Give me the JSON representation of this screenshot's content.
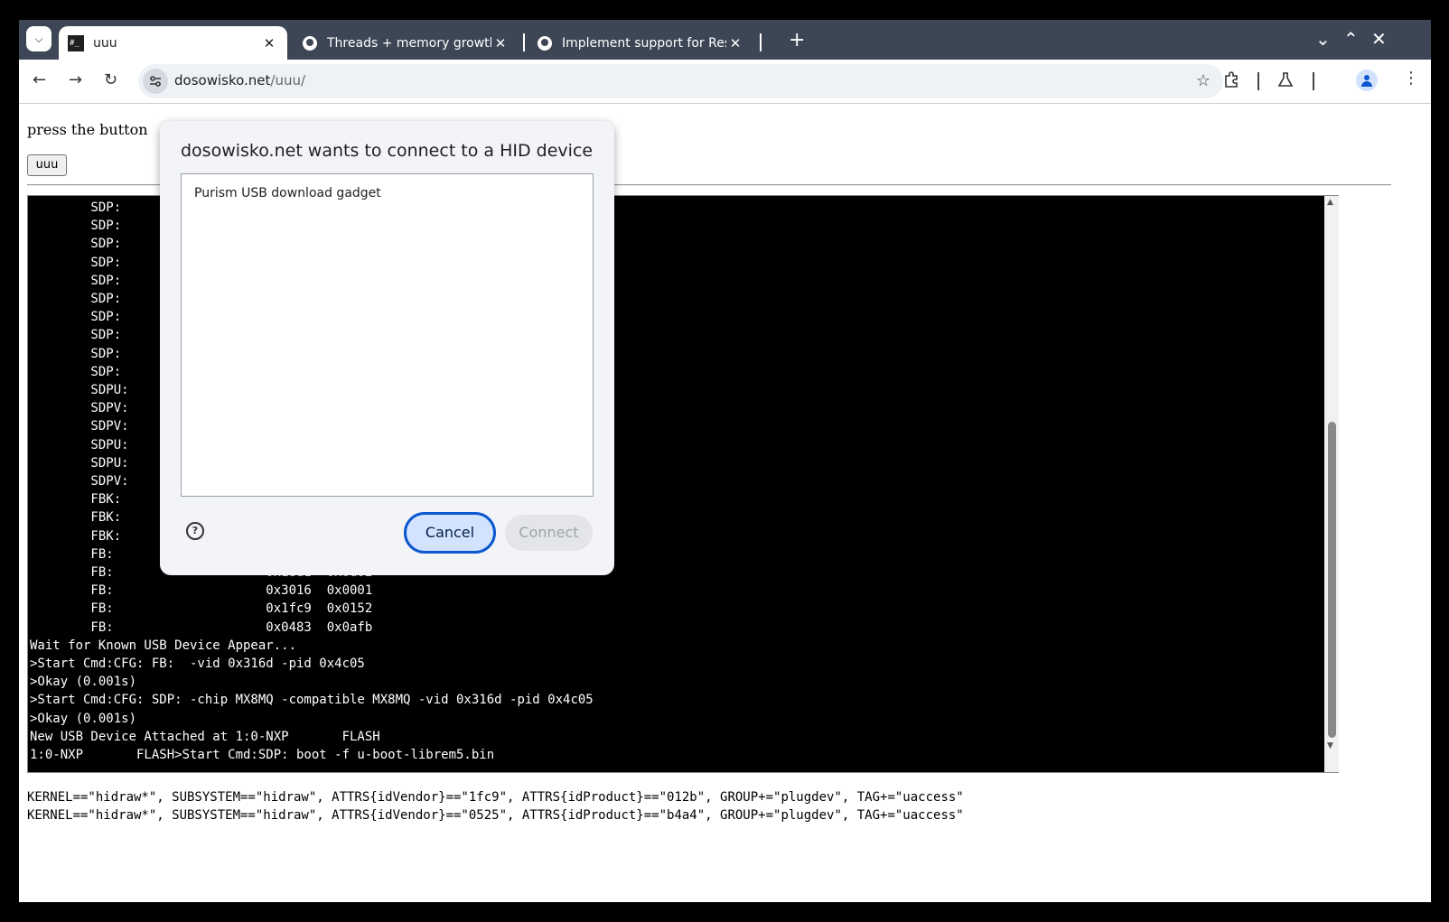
{
  "tabs": [
    {
      "title": "uuu",
      "favicon": "terminal-icon",
      "active": true
    },
    {
      "title": "Threads + memory growth -",
      "favicon": "github-icon",
      "active": false
    },
    {
      "title": "Implement support for Resiz",
      "favicon": "github-icon",
      "active": false
    }
  ],
  "toolbar": {
    "url_host": "dosowisko.net",
    "url_path": "/uuu/"
  },
  "page": {
    "press_text": "press the button",
    "button_label": "uuu",
    "terminal_text": "        SDP:\n        SDP:\n        SDP:\n        SDP:\n        SDP:\n        SDP:\n        SDP:\n        SDP:\n        SDP:\n        SDP:\n        SDPU:\n        SDPV:\n        SDPV:\n        SDPU:\n        SDPU:\n        SDPV:\n        FBK:\n        FBK:\n        FBK:\n        FB:                    0x0525  0xa4a5\n        FB:                    0x18d1  0x0d02\n        FB:                    0x3016  0x0001\n        FB:                    0x1fc9  0x0152\n        FB:                    0x0483  0x0afb\nWait for Known USB Device Appear...\n>Start Cmd:CFG: FB:  -vid 0x316d -pid 0x4c05\n>Okay (0.001s)\n>Start Cmd:CFG: SDP: -chip MX8MQ -compatible MX8MQ -vid 0x316d -pid 0x4c05\n>Okay (0.001s)\nNew USB Device Attached at 1:0-NXP       FLASH\n1:0-NXP       FLASH>Start Cmd:SDP: boot -f u-boot-librem5.bin",
    "udev_rules": "KERNEL==\"hidraw*\", SUBSYSTEM==\"hidraw\", ATTRS{idVendor}==\"1fc9\", ATTRS{idProduct}==\"012b\", GROUP+=\"plugdev\", TAG+=\"uaccess\"\nKERNEL==\"hidraw*\", SUBSYSTEM==\"hidraw\", ATTRS{idVendor}==\"0525\", ATTRS{idProduct}==\"b4a4\", GROUP+=\"plugdev\", TAG+=\"uaccess\""
  },
  "dialog": {
    "title": "dosowisko.net wants to connect to a HID device",
    "devices": [
      "Purism USB download gadget"
    ],
    "cancel_label": "Cancel",
    "connect_label": "Connect"
  },
  "colors": {
    "tabstrip_bg": "#3c4654",
    "accent": "#0b57d0",
    "cancel_bg": "#d3e3fd"
  }
}
